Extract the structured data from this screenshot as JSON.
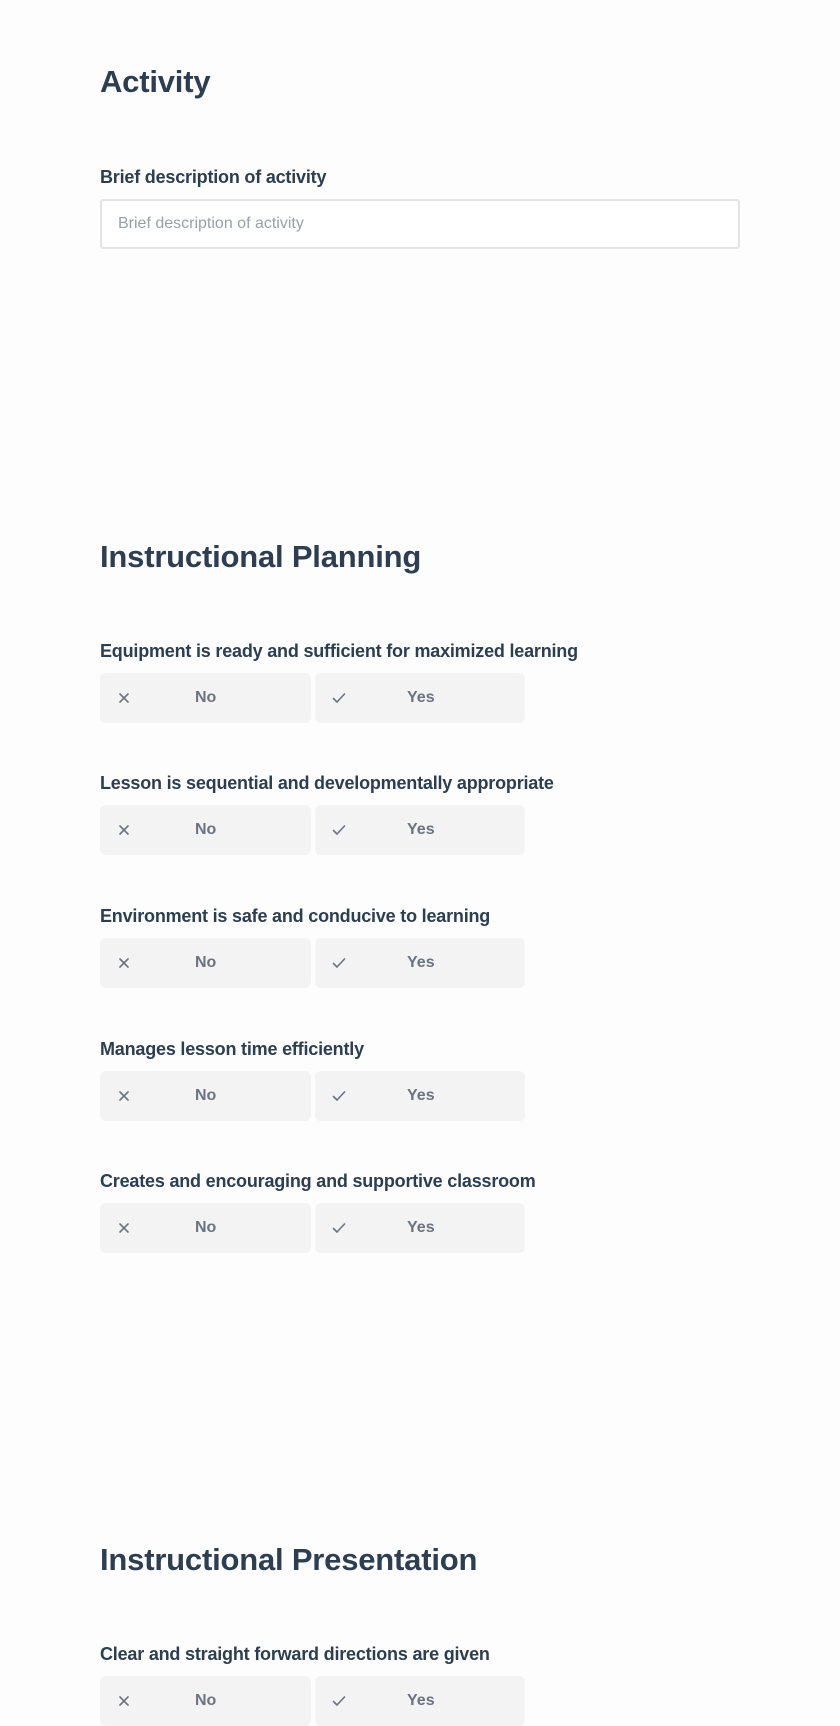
{
  "sections": [
    {
      "title": "Activity",
      "text_field": {
        "label": "Brief description of activity",
        "placeholder": "Brief description of activity",
        "value": ""
      }
    },
    {
      "title": "Instructional Planning",
      "questions": [
        {
          "label": "Equipment is ready and sufficient for maximized learning",
          "options": [
            {
              "icon": "x-icon",
              "label": "No"
            },
            {
              "icon": "check-icon",
              "label": "Yes"
            }
          ]
        },
        {
          "label": "Lesson is sequential and developmentally appropriate",
          "options": [
            {
              "icon": "x-icon",
              "label": "No"
            },
            {
              "icon": "check-icon",
              "label": "Yes"
            }
          ]
        },
        {
          "label": "Environment is safe and conducive to learning",
          "options": [
            {
              "icon": "x-icon",
              "label": "No"
            },
            {
              "icon": "check-icon",
              "label": "Yes"
            }
          ]
        },
        {
          "label": "Manages lesson time efficiently",
          "options": [
            {
              "icon": "x-icon",
              "label": "No"
            },
            {
              "icon": "check-icon",
              "label": "Yes"
            }
          ]
        },
        {
          "label": "Creates and encouraging and supportive classroom",
          "options": [
            {
              "icon": "x-icon",
              "label": "No"
            },
            {
              "icon": "check-icon",
              "label": "Yes"
            }
          ]
        }
      ]
    },
    {
      "title": "Instructional Presentation",
      "questions": [
        {
          "label": "Clear and straight forward directions are given",
          "options": [
            {
              "icon": "x-icon",
              "label": "No"
            },
            {
              "icon": "check-icon",
              "label": "Yes"
            }
          ]
        }
      ]
    }
  ],
  "colors": {
    "heading": "#2c3e50",
    "choice_bg": "#f3f3f4",
    "choice_text": "#6b7380",
    "input_border": "#e1e3e6",
    "placeholder": "#9aa0a8"
  }
}
